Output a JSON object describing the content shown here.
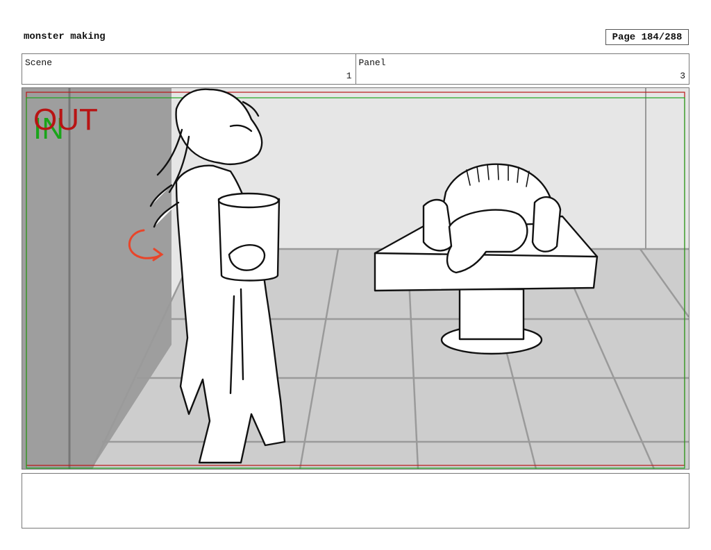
{
  "header": {
    "project_title": "monster making",
    "page_label": "Page 184/288"
  },
  "meta": {
    "scene_label": "Scene",
    "scene_value": "1",
    "panel_label": "Panel",
    "panel_value": "3"
  },
  "panel": {
    "in_marker": "IN",
    "out_marker": "OUT",
    "colors": {
      "in": "#1aa51a",
      "out": "#b81414",
      "arrow": "#e8452a",
      "wall_dark": "#9e9e9e",
      "wall_light": "#e6e6e6",
      "floor": "#cdcdcd"
    }
  },
  "notes": {
    "text": ""
  }
}
